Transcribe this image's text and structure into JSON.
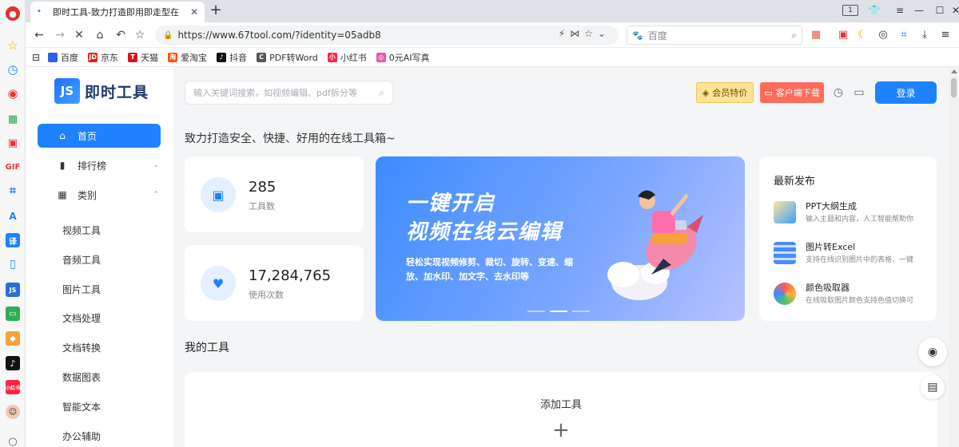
{
  "browser": {
    "tab_title": "即时工具-致力打造即用即走型在",
    "tab_close": "✕",
    "new_tab": "+",
    "url": "https://www.67tool.com/?identity=05adb8",
    "search_engine_placeholder": "百度",
    "tab_counter": "1",
    "bookmarks": [
      {
        "label": "百度",
        "color": "#2f5fe8",
        "glyph": "🐾"
      },
      {
        "label": "京东",
        "color": "#e1251b",
        "glyph": "JD"
      },
      {
        "label": "天猫",
        "color": "#d8151a",
        "glyph": "T"
      },
      {
        "label": "爱淘宝",
        "color": "#ff5000",
        "glyph": "淘"
      },
      {
        "label": "抖音",
        "color": "#111111",
        "glyph": "♪"
      },
      {
        "label": "PDF转Word",
        "color": "#555555",
        "glyph": "C"
      },
      {
        "label": "小红书",
        "color": "#ff2442",
        "glyph": "小"
      },
      {
        "label": "0元AI写真",
        "color": "#e95aa6",
        "glyph": "◎"
      }
    ]
  },
  "site": {
    "logo_mark": "JS",
    "logo_text": "即时工具",
    "search_placeholder": "输入关键词搜索，如视频编辑、pdf拆分等",
    "vip_label": "会员特价",
    "download_label": "客户端下载",
    "login_label": "登录",
    "slogan": "致力打造安全、快捷、好用的在线工具箱~"
  },
  "sidebar": {
    "menu": [
      {
        "label": "首页",
        "icon": "home-icon",
        "active": true
      },
      {
        "label": "排行榜",
        "icon": "chart-icon",
        "chevron": "⌄"
      },
      {
        "label": "类别",
        "icon": "grid-icon",
        "chevron": "⌃"
      }
    ],
    "categories": [
      "视频工具",
      "音频工具",
      "图片工具",
      "文档处理",
      "文档转换",
      "数据图表",
      "智能文本",
      "办公辅助"
    ]
  },
  "stats": [
    {
      "value": "285",
      "label": "工具数",
      "icon": "box-icon"
    },
    {
      "value": "17,284,765",
      "label": "使用次数",
      "icon": "heart-icon"
    }
  ],
  "banner": {
    "line1": "一键开启",
    "line2": "视频在线云编辑",
    "sub": "轻松实现视频修剪、裁切、旋转、变速、缩放、加水印、加文字、去水印等",
    "slide_index": 2,
    "slide_count": 3
  },
  "news": {
    "title": "最新发布",
    "items": [
      {
        "title": "PPT大纲生成",
        "desc": "输入主题和内容，人工智能帮助你",
        "color": "#3aa0ff"
      },
      {
        "title": "图片转Excel",
        "desc": "支持在线识别图片中的表格，一键",
        "color": "#4a8df8"
      },
      {
        "title": "颜色吸取器",
        "desc": "在线吸取图片颜色支持色值切换可",
        "color": "#ff8a3d"
      }
    ]
  },
  "mytools": {
    "title": "我的工具",
    "add_label": "添加工具",
    "add_plus": "+"
  }
}
